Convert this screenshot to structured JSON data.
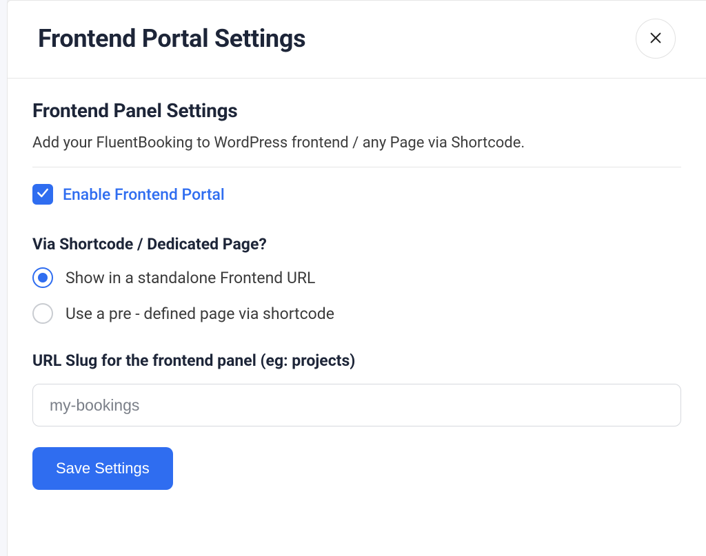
{
  "modal": {
    "title": "Frontend Portal Settings",
    "section_title": "Frontend Panel Settings",
    "section_desc": "Add your FluentBooking to WordPress frontend / any Page via Shortcode.",
    "enable_checkbox": {
      "label": "Enable Frontend Portal",
      "checked": true
    },
    "via_section": {
      "label": "Via Shortcode / Dedicated Page?",
      "options": [
        {
          "label": "Show in a standalone Frontend URL",
          "selected": true
        },
        {
          "label": "Use a pre - defined page via shortcode",
          "selected": false
        }
      ]
    },
    "url_slug": {
      "label": "URL Slug for the frontend panel (eg: projects)",
      "value": "my-bookings"
    },
    "save_label": "Save Settings"
  }
}
